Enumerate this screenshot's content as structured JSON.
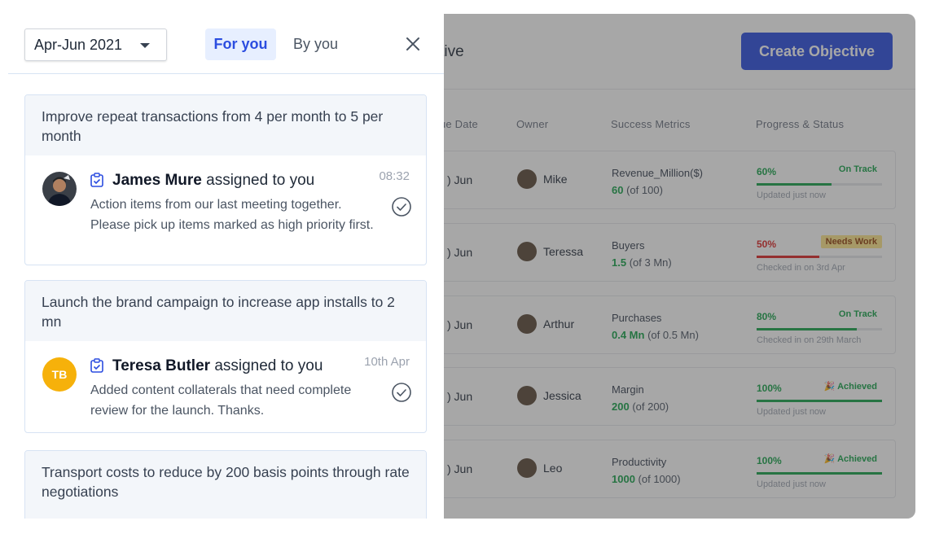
{
  "background": {
    "header_title_partial": "ective",
    "create_button": "Create Objective",
    "columns": [
      "ue Date",
      "Owner",
      "Success Metrics",
      "Progress & Status"
    ],
    "rows": [
      {
        "due": ") Jun",
        "owner": "Mike",
        "metric": "Revenue_Million($)",
        "value": "60",
        "of": "(of 100)",
        "percent": "60%",
        "progress": 0.6,
        "status": "On Track",
        "updated": "Updated just now",
        "status_color": "#16a34a"
      },
      {
        "due": ") Jun",
        "owner": "Teressa",
        "metric": "Buyers",
        "value": "1.5",
        "of": "(of 3 Mn)",
        "percent": "50%",
        "progress": 0.5,
        "status": "Needs Work",
        "updated": "Checked in on 3rd Apr",
        "status_color": "#dc2626"
      },
      {
        "due": ") Jun",
        "owner": "Arthur",
        "metric": "Purchases",
        "value": "0.4 Mn",
        "of": "(of 0.5 Mn)",
        "percent": "80%",
        "progress": 0.8,
        "status": "On Track",
        "updated": "Checked in on 29th March",
        "status_color": "#16a34a"
      },
      {
        "due": ") Jun",
        "owner": "Jessica",
        "metric": "Margin",
        "value": "200",
        "of": "(of 200)",
        "percent": "100%",
        "progress": 1.0,
        "status": "Achieved",
        "updated": "Updated just now",
        "status_color": "#16a34a"
      },
      {
        "due": ") Jun",
        "owner": "Leo",
        "metric": "Productivity",
        "value": "1000",
        "of": "(of 1000)",
        "percent": "100%",
        "progress": 1.0,
        "status": "Achieved",
        "updated": "Updated just now",
        "status_color": "#16a34a"
      }
    ]
  },
  "panel": {
    "quarter": "Apr-Jun 2021",
    "tabs": {
      "for_you": "For you",
      "by_you": "By you"
    },
    "notifications": [
      {
        "title": "Improve repeat transactions from 4 per month to 5 per month",
        "name": "James Mure",
        "action": "assigned to you",
        "time": "08:32",
        "message": "Action items from our last meeting together. Please pick up items marked as high priority first.",
        "avatar": "photo"
      },
      {
        "title": "Launch the brand campaign to increase app installs to 2 mn",
        "name": "Teresa Butler",
        "action": "assigned to you",
        "time": "10th Apr",
        "message": "Added content collaterals that need complete review for the launch. Thanks.",
        "initials": "TB"
      },
      {
        "title": "Transport costs to reduce by 200 basis points through rate negotiations"
      }
    ]
  },
  "colors": {
    "accent": "#2b4de0",
    "success": "#16a34a",
    "warning_bg": "#fde68a"
  }
}
